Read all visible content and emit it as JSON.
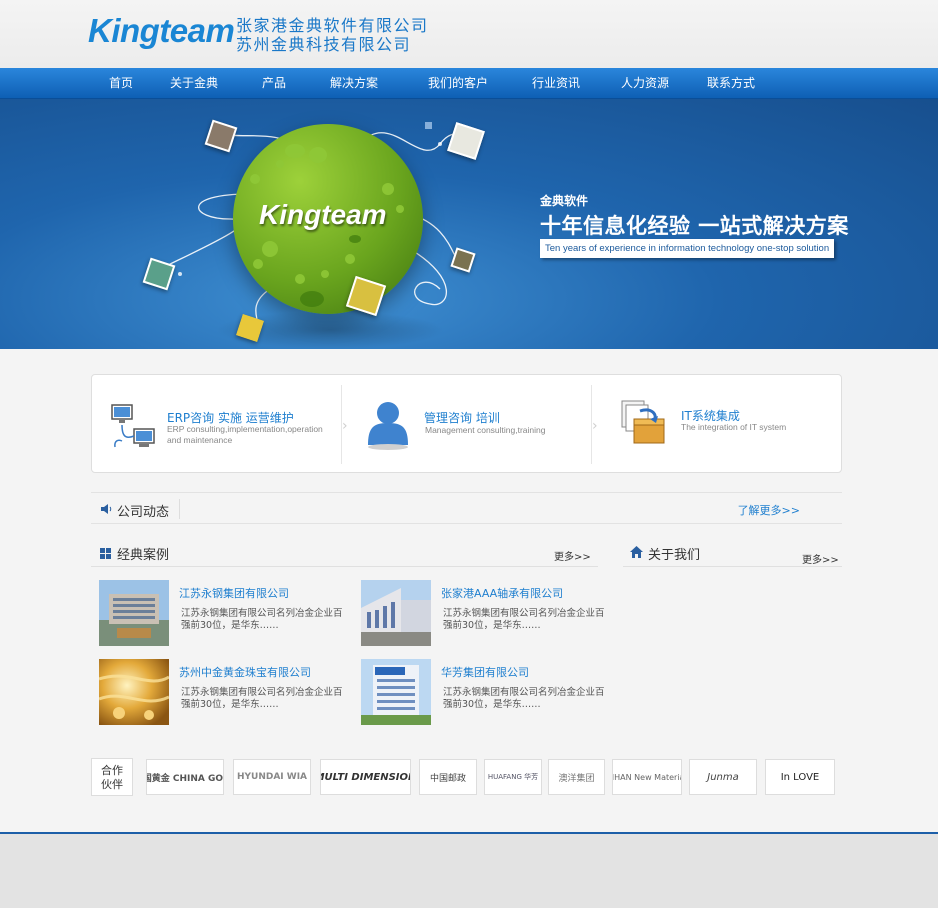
{
  "header": {
    "logo": "Kingteam",
    "company_line1": "张家港金典软件有限公司",
    "company_line2": "苏州金典科技有限公司"
  },
  "nav": [
    "首页",
    "关于金典",
    "产品",
    "解决方案",
    "我们的客户",
    "行业资讯",
    "人力资源",
    "联系方式"
  ],
  "banner": {
    "globe_text": "Kingteam",
    "small": "金典软件",
    "big": "十年信息化经验 一站式解决方案",
    "en": "Ten years of experience in information technology one-stop solution"
  },
  "services": [
    {
      "title": "ERP咨询 实施 运营维护",
      "desc": "ERP consulting,implementation,operation and maintenance",
      "icon": "computer-network-icon"
    },
    {
      "title": "管理咨询 培训",
      "desc": "Management consulting,training",
      "icon": "person-icon"
    },
    {
      "title": "IT系统集成",
      "desc": "The integration of IT system",
      "icon": "box-integration-icon"
    }
  ],
  "news": {
    "title": "公司动态",
    "more": "了解更多>>"
  },
  "cases": {
    "title": "经典案例",
    "more": "更多>>",
    "items": [
      {
        "name": "江苏永钢集团有限公司",
        "desc": "江苏永钢集团有限公司名列冶金企业百强前30位，是华东……"
      },
      {
        "name": "张家港AAA轴承有限公司",
        "desc": "江苏永钢集团有限公司名列冶金企业百强前30位，是华东……"
      },
      {
        "name": "苏州中金黄金珠宝有限公司",
        "desc": "江苏永钢集团有限公司名列冶金企业百强前30位，是华东……"
      },
      {
        "name": "华芳集团有限公司",
        "desc": "江苏永钢集团有限公司名列冶金企业百强前30位，是华东……"
      }
    ]
  },
  "about": {
    "title": "关于我们",
    "more": "更多>>"
  },
  "partners": {
    "label_line1": "合作",
    "label_line2": "伙伴",
    "items": [
      "中国黄金 CHINA GOLD",
      "HYUNDAI WIA",
      "MULTI DIMENSION",
      "中国邮政",
      "HUAFANG 华芳",
      "澳洋集团",
      "LIHAN New Material",
      "Junma",
      "In LOVE"
    ]
  },
  "colors": {
    "brand": "#1a86d4",
    "nav": "#1566c0",
    "link": "#1f7fcf",
    "globe": "#6aa51e"
  }
}
